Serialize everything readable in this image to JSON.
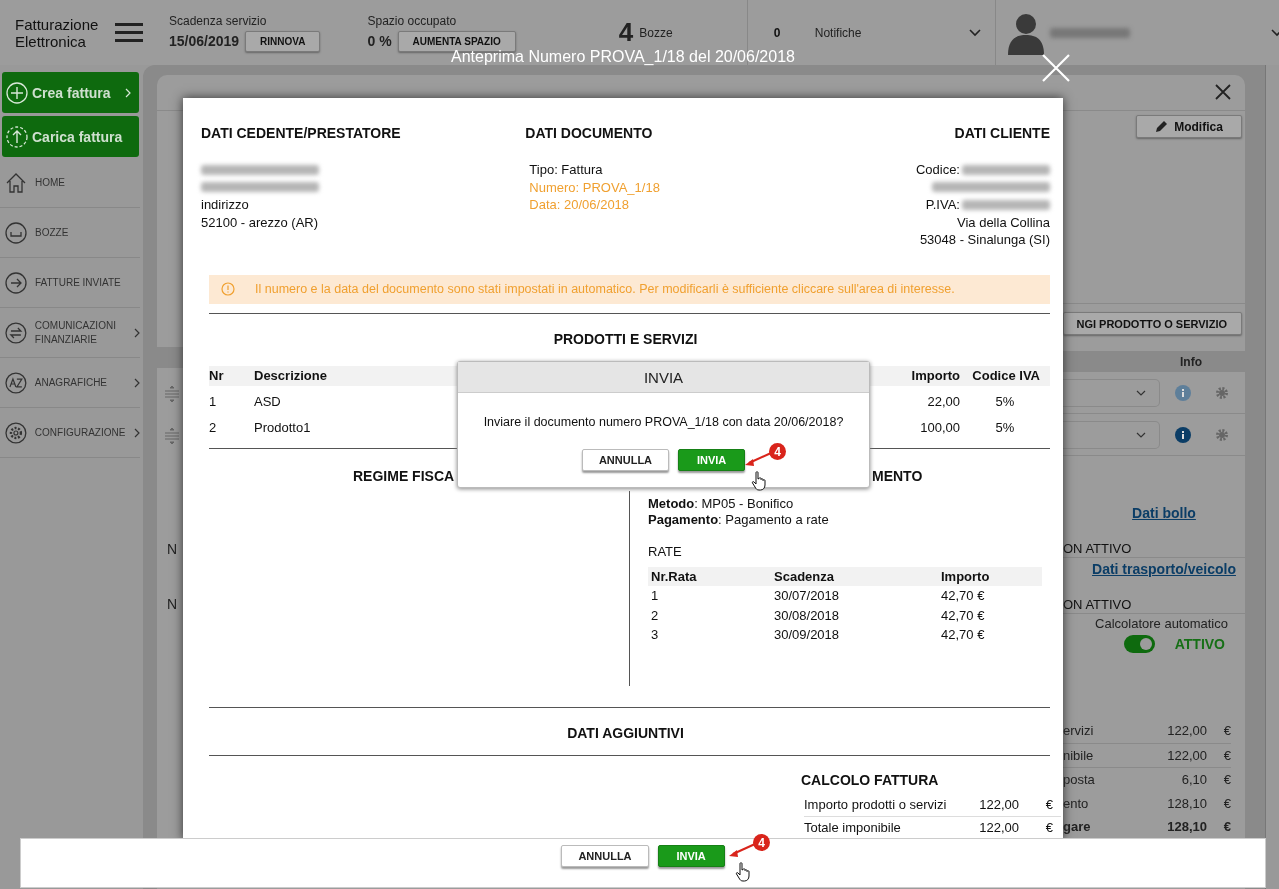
{
  "header": {
    "logo": "Fatturazione Elettronica",
    "service_label": "Scadenza servizio",
    "service_date": "15/06/2019",
    "renew_button": "RINNOVA",
    "space_label": "Spazio occupato",
    "space_value": "0 %",
    "space_button": "AUMENTA SPAZIO",
    "drafts_count": "4",
    "drafts_label": "Bozze",
    "notifications_count": "0",
    "notifications_label": "Notifiche"
  },
  "sidebar": {
    "actions": [
      {
        "kind": "create",
        "label": "Crea fattura",
        "submenu": true
      },
      {
        "kind": "upload",
        "label": "Carica fattura",
        "submenu": false
      }
    ],
    "items": [
      {
        "kind": "home",
        "label": "HOME",
        "submenu": false
      },
      {
        "kind": "drafts",
        "label": "BOZZE",
        "submenu": false
      },
      {
        "kind": "sent",
        "label": "FATTURE INVIATE",
        "submenu": false
      },
      {
        "kind": "exchange",
        "label": "COMUNICAZIONI FINANZIARIE",
        "submenu": true
      },
      {
        "kind": "registry",
        "label": "ANAGRAFICHE",
        "submenu": true
      },
      {
        "kind": "settings",
        "label": "CONFIGURAZIONE",
        "submenu": true
      }
    ]
  },
  "background_form": {
    "edit_button": "Modifica",
    "add_button": "NGI PRODOTTO O SERVIZIO",
    "table_header": "Info",
    "rows": [
      {
        "info_active": false
      },
      {
        "info_active": true
      }
    ],
    "left_fragments": [
      "N",
      "N"
    ],
    "sections": [
      {
        "kind": "link",
        "text": "Dati bollo"
      },
      {
        "kind": "status",
        "text": "ON ATTIVO"
      },
      {
        "kind": "link",
        "text": "Dati trasporto/veicolo"
      },
      {
        "kind": "status",
        "text": "ON ATTIVO"
      }
    ],
    "calculator": {
      "label": "Calcolatore automatico",
      "on": true,
      "state": "ATTIVO"
    },
    "totals": [
      {
        "label": "ervizi",
        "value": "122,00",
        "currency": "€",
        "bold": false
      },
      {
        "label": "nibile",
        "value": "122,00",
        "currency": "€",
        "bold": false
      },
      {
        "label": "posta",
        "value": "6,10",
        "currency": "€",
        "bold": false
      },
      {
        "label": "ento",
        "value": "128,10",
        "currency": "€",
        "bold": false
      },
      {
        "label": "gare",
        "value": "128,10",
        "currency": "€",
        "bold": true
      }
    ]
  },
  "preview": {
    "title": "Anteprima Numero PROVA_1/18 del 20/06/2018",
    "seller": {
      "heading": "DATI CEDENTE/PRESTATORE",
      "lines": [
        {
          "kind": "blurred"
        },
        {
          "kind": "blurred"
        },
        {
          "kind": "text",
          "text": "indirizzo"
        },
        {
          "kind": "text",
          "text": "52100 - arezzo (AR)"
        }
      ]
    },
    "document": {
      "heading": "DATI DOCUMENTO",
      "lines": [
        {
          "text": "Tipo: Fattura",
          "highlight": false
        },
        {
          "text": "Numero: PROVA_1/18",
          "highlight": true
        },
        {
          "text": "Data: 20/06/2018",
          "highlight": true
        }
      ]
    },
    "client": {
      "heading": "DATI CLIENTE",
      "lines": [
        {
          "kind": "labeled",
          "text": "Codice:"
        },
        {
          "kind": "blurred"
        },
        {
          "kind": "labeled",
          "text": "P.IVA:"
        },
        {
          "kind": "text",
          "text": "Via della Collina"
        },
        {
          "kind": "text",
          "text": "53048 - Sinalunga (SI)"
        }
      ]
    },
    "notice": "Il numero e la data del documento sono stati impostati in automatico. Per modificarli è sufficiente cliccare sull'area di interesse.",
    "products": {
      "heading": "PRODOTTI E SERVIZI",
      "columns": [
        "Nr",
        "Descrizione",
        "Importo",
        "Codice IVA"
      ],
      "rows": [
        [
          "1",
          "ASD",
          "22,00",
          "5%"
        ],
        [
          "2",
          "Prodotto1",
          "100,00",
          "5%"
        ]
      ]
    },
    "regime_heading": "REGIME FISCA",
    "payment": {
      "heading": "MENTO",
      "lines": [
        "**Metodo**: MP05 - Bonifico",
        "**Pagamento**: Pagamento a rate"
      ],
      "rate_label": "RATE",
      "columns": [
        "Nr.Rata",
        "Scadenza",
        "Importo"
      ],
      "rows": [
        [
          "1",
          "30/07/2018",
          "42,70 €"
        ],
        [
          "2",
          "30/08/2018",
          "42,70 €"
        ],
        [
          "3",
          "30/09/2018",
          "42,70 €"
        ]
      ]
    },
    "extra_heading": "DATI AGGIUNTIVI",
    "calc": {
      "heading": "CALCOLO FATTURA",
      "rows": [
        {
          "label": "Importo prodotti o servizi",
          "value": "122,00",
          "currency": "€"
        },
        {
          "label": "Totale imponibile",
          "value": "122,00",
          "currency": "€"
        }
      ]
    }
  },
  "confirm": {
    "title": "INVIA",
    "message": "Inviare il documento numero PROVA_1/18 con data 20/06/2018?",
    "cancel": "ANNULLA",
    "confirm": "INVIA",
    "step": "4"
  },
  "footer": {
    "cancel": "ANNULLA",
    "confirm": "INVIA",
    "step": "4"
  }
}
